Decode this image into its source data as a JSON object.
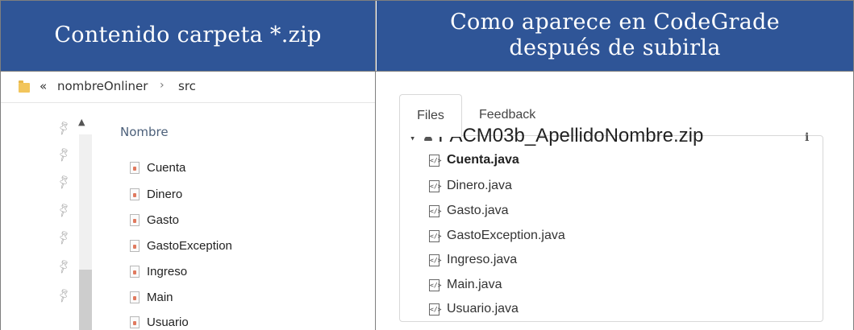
{
  "headers": {
    "left": "Contenido carpeta *.zip",
    "right_line1": "Como aparece en CodeGrade",
    "right_line2": "después de subirla"
  },
  "explorer": {
    "breadcrumb": {
      "overflow": "«",
      "folder": "nombreOnliner",
      "separator": "›",
      "subfolder": "src"
    },
    "column_header": "Nombre",
    "files": [
      "Cuenta",
      "Dinero",
      "Gasto",
      "GastoException",
      "Ingreso",
      "Main",
      "Usuario"
    ]
  },
  "codegrade": {
    "tabs": [
      "Files",
      "Feedback"
    ],
    "active_tab": "Files",
    "root": "PACM03b_ApellidoNombre.zip",
    "info_icon": "i",
    "files": [
      "Cuenta.java",
      "Dinero.java",
      "Gasto.java",
      "GastoException.java",
      "Ingreso.java",
      "Main.java",
      "Usuario.java"
    ],
    "selected_file": "Cuenta.java"
  },
  "colors": {
    "header_bg": "#2f5597",
    "header_text": "#ffffff"
  },
  "icons": {
    "folder": "folder-icon",
    "pin": "pin-icon",
    "java_file": "java-file-icon",
    "code_file": "code-file-icon",
    "user": "user-icon",
    "caret": "caret-down-icon",
    "info": "info-icon"
  }
}
